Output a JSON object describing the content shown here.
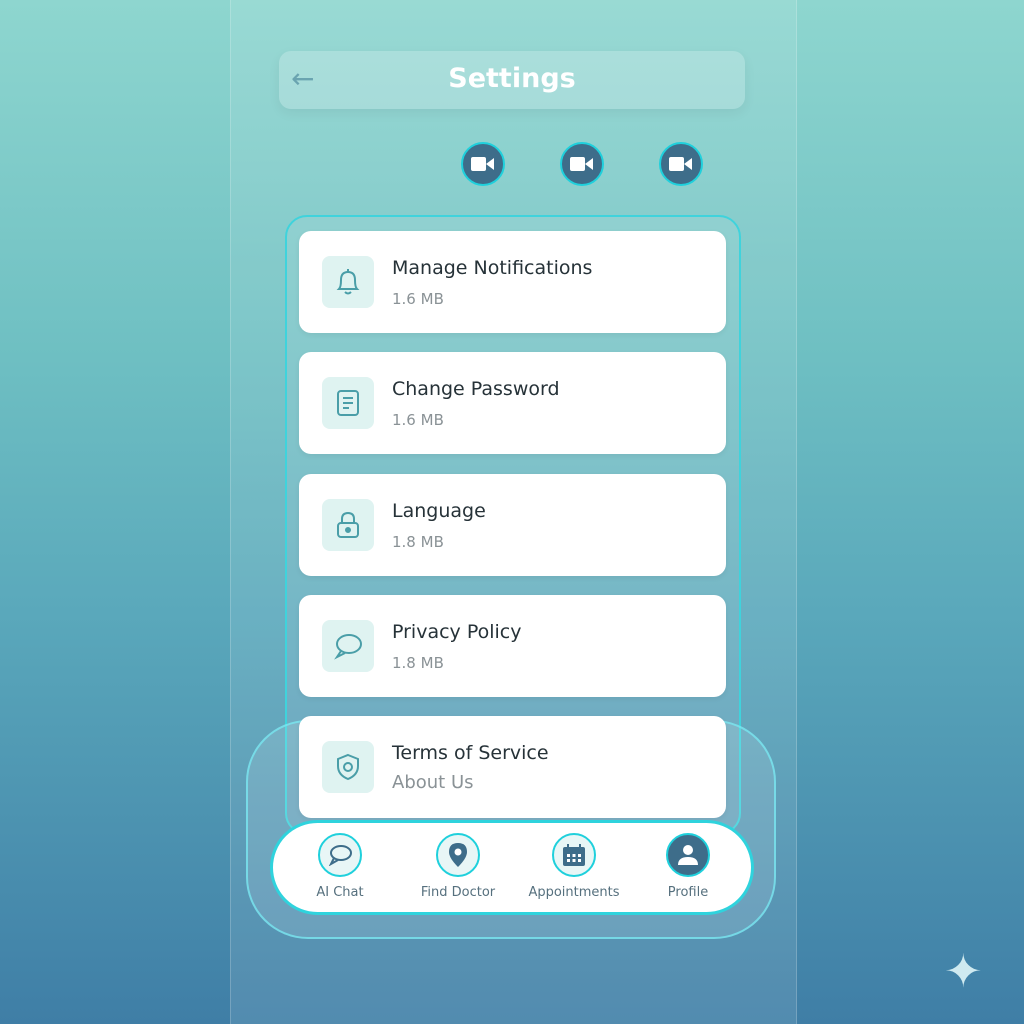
{
  "header": {
    "title": "Settings",
    "back_icon": "arrow-left-icon"
  },
  "video_buttons": [
    {
      "icon": "video-camera-icon"
    },
    {
      "icon": "video-camera-icon"
    },
    {
      "icon": "video-camera-icon"
    }
  ],
  "settings": [
    {
      "label": "Manage Notifications",
      "sub": "1.6 MB",
      "icon": "bell-icon"
    },
    {
      "label": "Change Password",
      "sub": "1.6 MB",
      "icon": "document-icon"
    },
    {
      "label": "Language",
      "sub": "1.8 MB",
      "icon": "lock-icon"
    },
    {
      "label": "Privacy Policy",
      "sub": "1.8 MB",
      "icon": "chat-bubble-icon"
    },
    {
      "label": "Terms of Service",
      "sub": "About Us",
      "icon": "shield-icon"
    }
  ],
  "nav": [
    {
      "label": "AI Chat",
      "icon": "chat-bubble-icon"
    },
    {
      "label": "Find Doctor",
      "icon": "map-pin-icon"
    },
    {
      "label": "Appointments",
      "icon": "calendar-icon"
    },
    {
      "label": "Profile",
      "icon": "user-icon",
      "active": true
    }
  ],
  "colors": {
    "accent": "#1fd0dc",
    "dark": "#3e6d8a",
    "icon": "#4a9ea8"
  }
}
